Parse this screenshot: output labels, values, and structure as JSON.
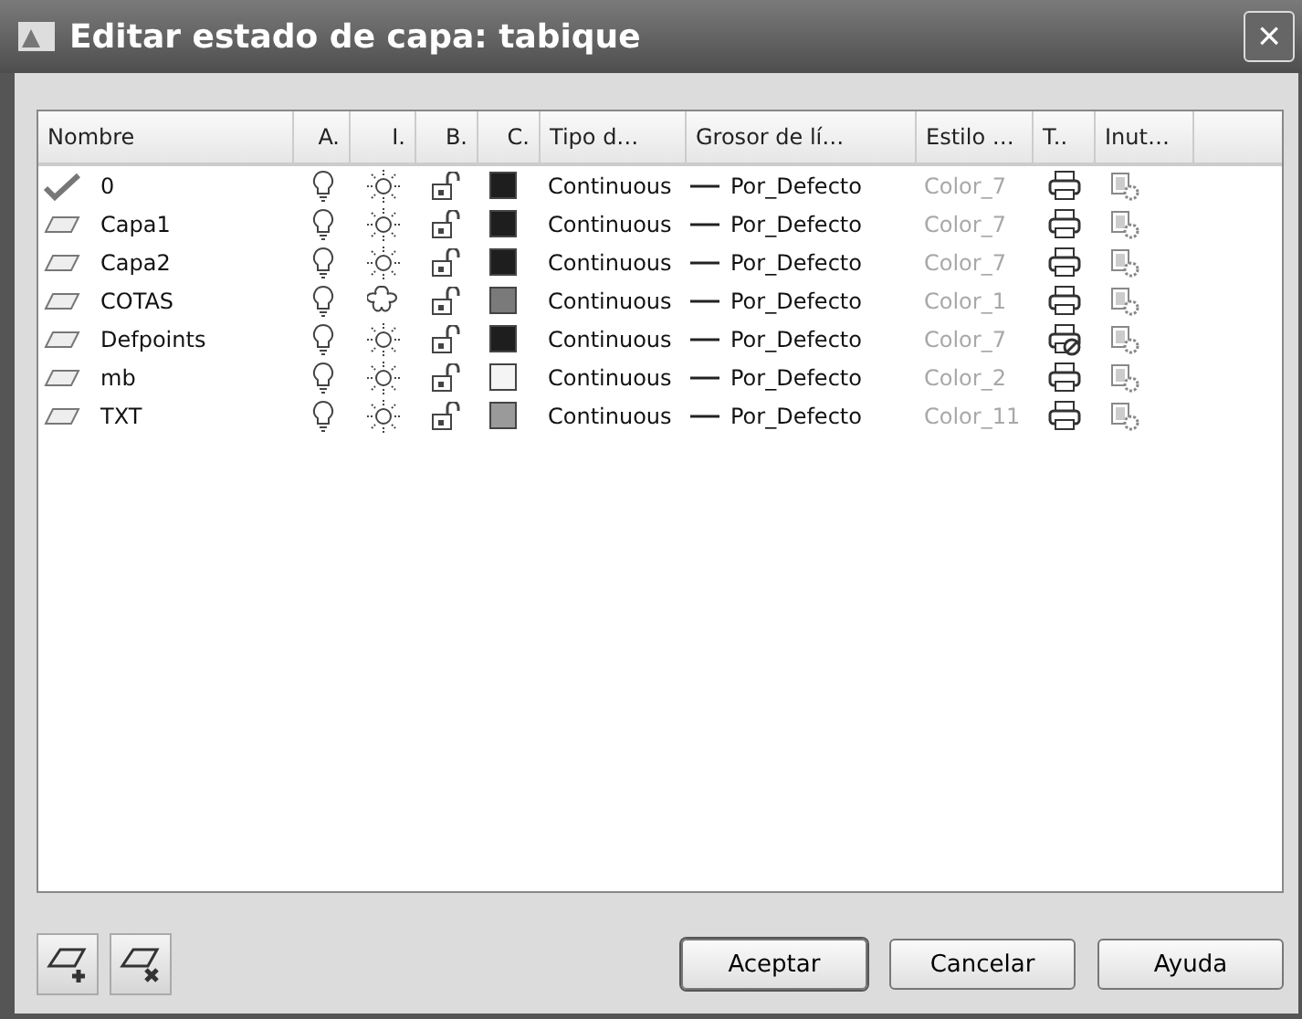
{
  "window": {
    "title": "Editar estado de capa: tabique",
    "close": "×"
  },
  "table": {
    "columns": [
      "Nombre",
      "A.",
      "I.",
      "B.",
      "C.",
      "Tipo d…",
      "Grosor de lí…",
      "Estilo …",
      "T..",
      "Inut…"
    ],
    "rows": [
      {
        "name": "0",
        "current": true,
        "on": true,
        "frozen": false,
        "locked": false,
        "color": "#1e1e1e",
        "linetype": "Continuous",
        "lineweight": "Por_Defecto",
        "plot_style": "Color_7",
        "plot": true,
        "selected": false
      },
      {
        "name": "Capa1",
        "current": false,
        "on": true,
        "frozen": false,
        "locked": false,
        "color": "#1e1e1e",
        "linetype": "Continuous",
        "lineweight": "Por_Defecto",
        "plot_style": "Color_7",
        "plot": true,
        "selected": false
      },
      {
        "name": "Capa2",
        "current": false,
        "on": true,
        "frozen": false,
        "locked": false,
        "color": "#1e1e1e",
        "linetype": "Continuous",
        "lineweight": "Por_Defecto",
        "plot_style": "Color_7",
        "plot": true,
        "selected": false
      },
      {
        "name": "COTAS",
        "current": false,
        "on": true,
        "frozen": true,
        "locked": false,
        "color": "#7a7a7a",
        "linetype": "Continuous",
        "lineweight": "Por_Defecto",
        "plot_style": "Color_1",
        "plot": true,
        "selected": false
      },
      {
        "name": "Defpoints",
        "current": false,
        "on": true,
        "frozen": false,
        "locked": false,
        "color": "#1e1e1e",
        "linetype": "Continuous",
        "lineweight": "Por_Defecto",
        "plot_style": "Color_7",
        "plot": false,
        "selected": false
      },
      {
        "name": "mb",
        "current": false,
        "on": true,
        "frozen": false,
        "locked": false,
        "color": "#f4f4f4",
        "linetype": "Continuous",
        "lineweight": "Por_Defecto",
        "plot_style": "Color_2",
        "plot": true,
        "selected": false
      },
      {
        "name": "TXT",
        "current": false,
        "on": true,
        "frozen": false,
        "locked": false,
        "color": "#9a9a9a",
        "linetype": "Continuous",
        "lineweight": "Por_Defecto",
        "plot_style": "Color_11",
        "plot": true,
        "selected": false
      }
    ]
  },
  "buttons": [
    "Aceptar",
    "Cancelar",
    "Ayuda"
  ]
}
